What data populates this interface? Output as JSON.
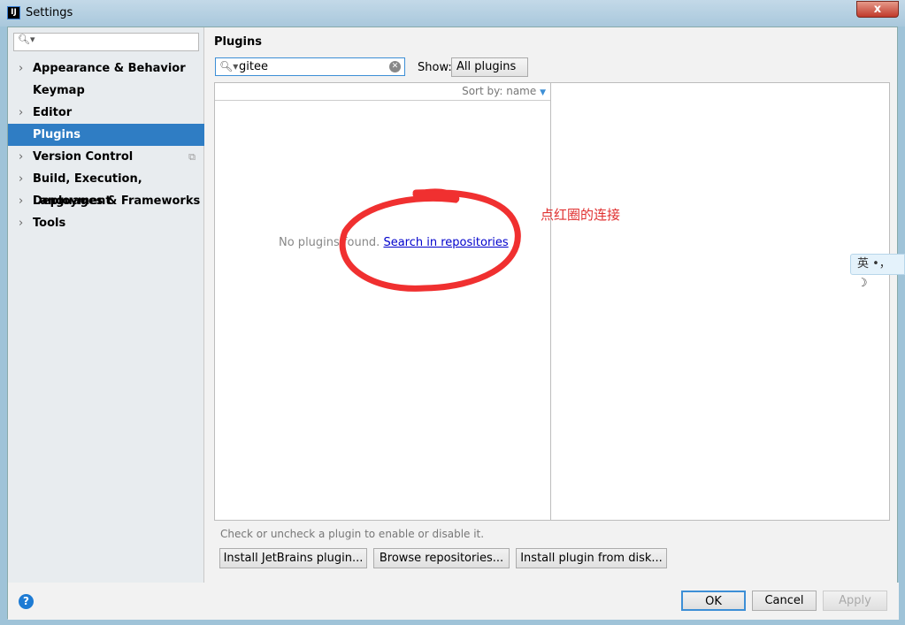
{
  "window": {
    "title": "Settings",
    "close": "x"
  },
  "sidebar": {
    "search_placeholder": "",
    "items": [
      {
        "label": "Appearance & Behavior",
        "expandable": true
      },
      {
        "label": "Keymap",
        "expandable": false
      },
      {
        "label": "Editor",
        "expandable": true
      },
      {
        "label": "Plugins",
        "expandable": false,
        "selected": true
      },
      {
        "label": "Version Control",
        "expandable": true
      },
      {
        "label": "Build, Execution, Deployment",
        "expandable": true
      },
      {
        "label": "Languages & Frameworks",
        "expandable": true
      },
      {
        "label": "Tools",
        "expandable": true
      }
    ]
  },
  "plugins": {
    "heading": "Plugins",
    "search_value": "gitee",
    "show_label": "Show:",
    "show_value": "All plugins",
    "sort_label": "Sort by: name",
    "empty_text": "No plugins found.",
    "search_link": "Search in repositories",
    "hint": "Check or uncheck a plugin to enable or disable it.",
    "buttons": {
      "install_jetbrains": "Install JetBrains plugin...",
      "browse": "Browse repositories...",
      "install_disk": "Install plugin from disk..."
    }
  },
  "footer": {
    "help": "?",
    "ok": "OK",
    "cancel": "Cancel",
    "apply": "Apply"
  },
  "annotation": {
    "text": "点红圈的连接",
    "color": "#e03030"
  },
  "ime": {
    "text": "英 •，"
  },
  "colors": {
    "selection": "#2f7dc4",
    "link": "#0000cc"
  }
}
